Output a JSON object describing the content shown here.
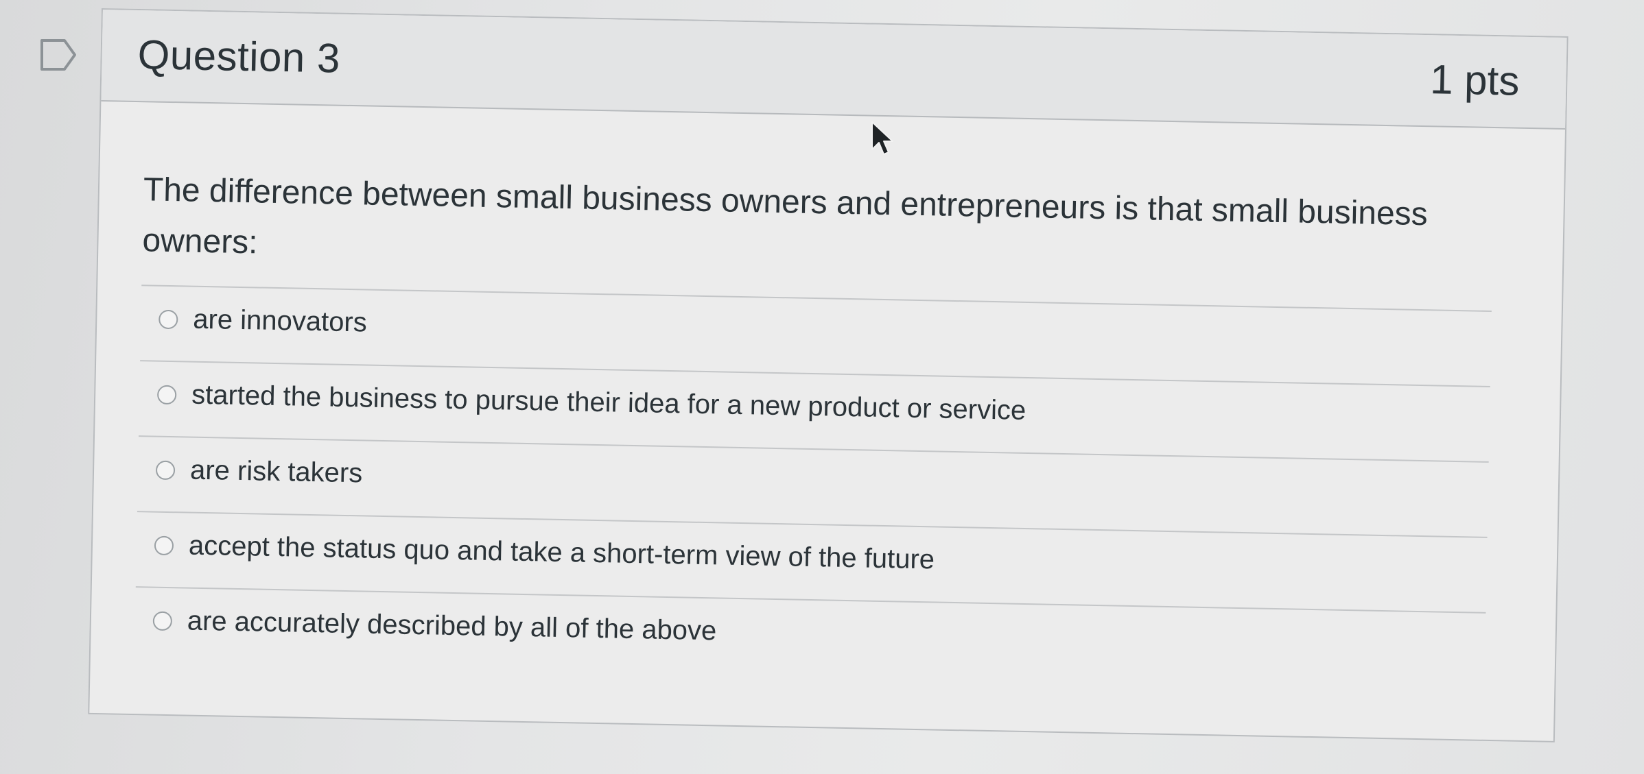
{
  "question": {
    "title": "Question 3",
    "points": "1 pts",
    "text": "The difference between small business owners and entrepreneurs is that small business owners:"
  },
  "answers": [
    {
      "label": "are innovators"
    },
    {
      "label": "started the business to pursue their idea for a new product or service"
    },
    {
      "label": "are risk takers"
    },
    {
      "label": "accept the status quo and take a short-term view of the future"
    },
    {
      "label": "are accurately described by all of the above"
    }
  ],
  "icons": {
    "flag": "flag-question-icon",
    "cursor": "mouse-pointer-icon"
  }
}
